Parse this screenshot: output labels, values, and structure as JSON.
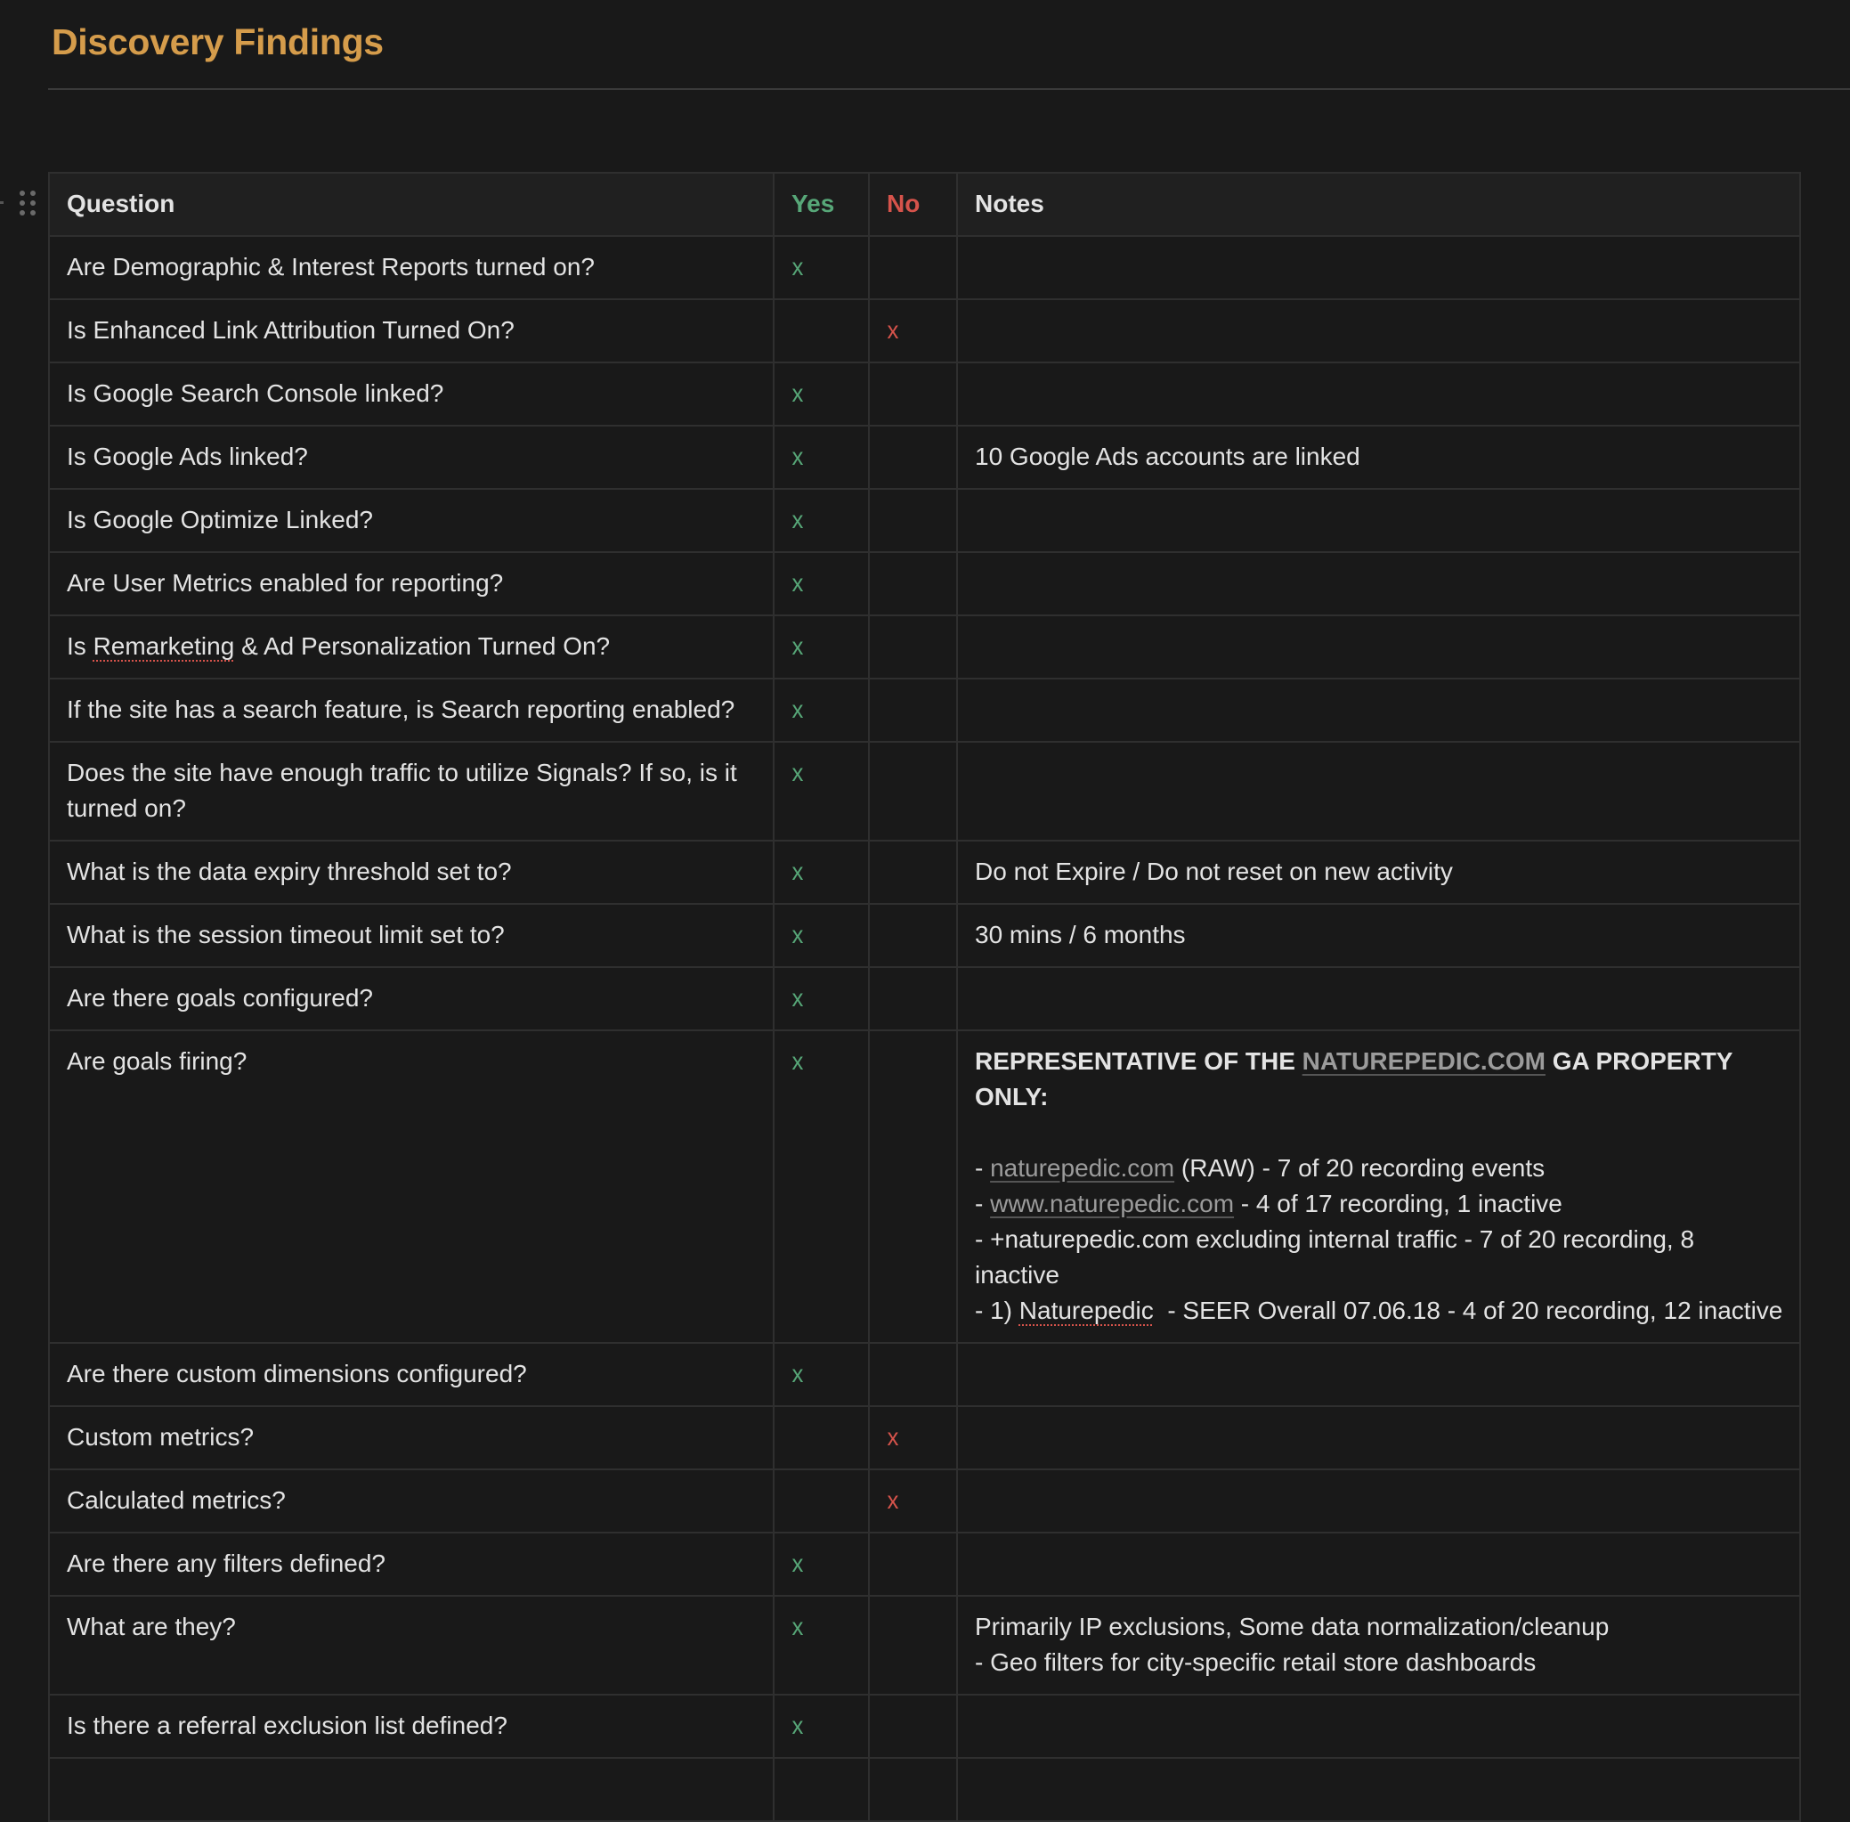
{
  "page": {
    "title": "Discovery Findings"
  },
  "table": {
    "headers": {
      "question": "Question",
      "yes": "Yes",
      "no": "No",
      "notes": "Notes"
    },
    "mark": "x",
    "colors": {
      "title": "#d59c4b",
      "yes": "#57a778",
      "no": "#d6534b"
    },
    "rows": [
      {
        "question": "Are Demographic & Interest Reports turned on?",
        "yes": "x",
        "no": "",
        "notes": ""
      },
      {
        "question": "Is Enhanced Link Attribution Turned On?",
        "yes": "",
        "no": "x",
        "notes": ""
      },
      {
        "question": "Is Google Search Console linked?",
        "yes": "x",
        "no": "",
        "notes": ""
      },
      {
        "question": "Is Google Ads linked?",
        "yes": "x",
        "no": "",
        "notes": "10 Google Ads accounts are linked"
      },
      {
        "question": "Is Google Optimize Linked?",
        "yes": "x",
        "no": "",
        "notes": ""
      },
      {
        "question": "Are User Metrics enabled for reporting?",
        "yes": "x",
        "no": "",
        "notes": ""
      },
      {
        "question_prefix": "Is ",
        "question_flagged": "Remarketing",
        "question_suffix": " & Ad Personalization Turned On?",
        "yes": "x",
        "no": "",
        "notes": ""
      },
      {
        "question": "If the site has a search feature, is Search reporting enabled?",
        "yes": "x",
        "no": "",
        "notes": ""
      },
      {
        "question": "Does the site have enough traffic to utilize Signals? If so, is it turned on?",
        "yes": "x",
        "no": "",
        "notes": ""
      },
      {
        "question": "What is the data expiry threshold set to?",
        "yes": "x",
        "no": "",
        "notes": "Do not Expire / Do not reset on new activity"
      },
      {
        "question": "What is the session timeout limit set to?",
        "yes": "x",
        "no": "",
        "notes": "30 mins / 6 months"
      },
      {
        "question": "Are there goals configured?",
        "yes": "x",
        "no": "",
        "notes": ""
      },
      {
        "question": "Are goals firing?",
        "yes": "x",
        "no": "",
        "notes_rich": {
          "heading_prefix": "REPRESENTATIVE OF THE ",
          "heading_link": "NATUREPEDIC.COM",
          "heading_suffix": " GA PROPERTY ONLY:",
          "line1_prefix": "- ",
          "line1_link": "naturepedic.com",
          "line1_suffix": " (RAW) - 7 of 20 recording events",
          "line2_prefix": "- ",
          "line2_link": "www.naturepedic.com",
          "line2_suffix": " - 4 of 17 recording, 1 inactive",
          "line3": "- +naturepedic.com excluding internal traffic - 7 of 20 recording, 8 inactive",
          "line4_prefix": "- 1) ",
          "line4_flagged": "Naturepedic",
          "line4_suffix": "  - SEER Overall 07.06.18 - 4 of 20 recording, 12 inactive"
        }
      },
      {
        "question": "Are there custom dimensions configured?",
        "yes": "x",
        "no": "",
        "notes": ""
      },
      {
        "question": "Custom metrics?",
        "yes": "",
        "no": "x",
        "notes": ""
      },
      {
        "question": "Calculated metrics?",
        "yes": "",
        "no": "x",
        "notes": ""
      },
      {
        "question": "Are there any filters defined?",
        "yes": "x",
        "no": "",
        "notes": ""
      },
      {
        "question": "What are they?",
        "yes": "x",
        "no": "",
        "notes_lines": [
          "Primarily IP exclusions, Some data normalization/cleanup",
          "- Geo filters for city-specific retail store dashboards"
        ]
      },
      {
        "question": "Is there a referral exclusion list defined?",
        "yes": "x",
        "no": "",
        "notes": ""
      }
    ]
  }
}
